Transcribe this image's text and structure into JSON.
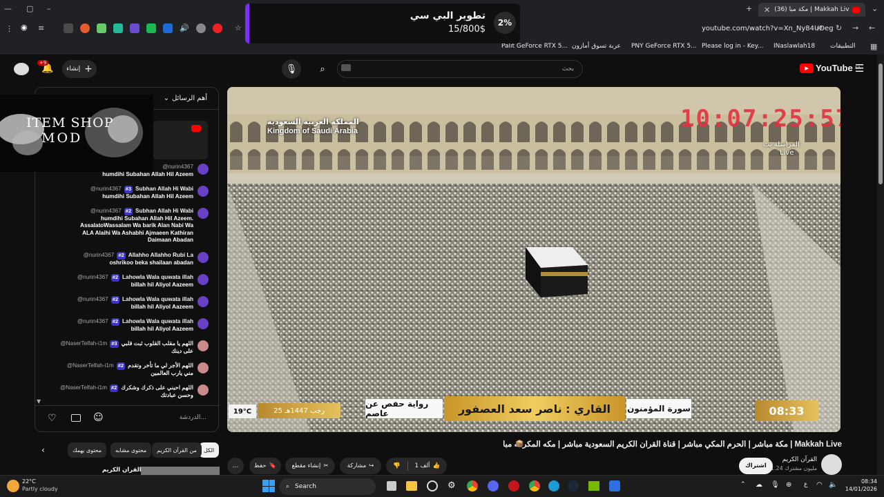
{
  "browser": {
    "tab_title": "(36) ‫ً Makkah Live | مكة مبا",
    "url": "youtube.com/watch?v=Xn_Ny84UDeg",
    "bookmarks": [
      "التطبيقات",
      "INaslawlah18",
      "Please log in - Key...",
      "PNY GeForce RTX 5...",
      "عربة تسوق أمازون",
      "Palit GeForce RTX 5..."
    ]
  },
  "promo": {
    "percent": "2%",
    "title": "تطوير البي سي",
    "amount": "15/800$"
  },
  "header": {
    "logo_text": "YouTube",
    "logo_region": "SA",
    "search_placeholder": "بحث",
    "create_label": "إنشاء",
    "notif_count": "+9"
  },
  "chat": {
    "mode_label": "أهم الرسائل",
    "input_placeholder": "الدردشة...",
    "messages": [
      {
        "author": "@nurin4367",
        "badge": "",
        "text": "",
        "line2": "humdihi Subahan Allah Hil Azeem"
      },
      {
        "author": "@nurin4367",
        "badge": "#3",
        "text": "Subhan Allah Hi Wabi",
        "line2": "humdihi Subahan Allah Hil Azeem"
      },
      {
        "author": "@nurin4367",
        "badge": "#2",
        "text": "Subhan Allah Hi Wabi",
        "line2": "humdihi Subahan Allah Hil Azeem. AssalatoWassalam Wa barik Alan Nabi Wa ALA Alaihi Wa Ashabhi Ajmaeen Kathiran Daimaan Abadan"
      },
      {
        "author": "@nurin4367",
        "badge": "#2",
        "text": "Allahho Allahho Rubi La",
        "line2": "oshrikoo beka shailaan abadan"
      },
      {
        "author": "@nurin4367",
        "badge": "#2",
        "text": "Lahowla Wala quwata illah",
        "line2": "billah hil Aliyol Aazeem"
      },
      {
        "author": "@nurin4367",
        "badge": "#2",
        "text": "Lahowla Wala quwata illah",
        "line2": "billah hil Aliyol Aazeem"
      },
      {
        "author": "@nurin4367",
        "badge": "#2",
        "text": "Lahowla Wala quwata illah",
        "line2": "billah hil Aliyol Aazeem"
      },
      {
        "author": "@NaserTelfah-i1m",
        "badge": "#3",
        "text": "اللهم يا مقلب القلوب ثبت قلبي",
        "line2": "على دينك"
      },
      {
        "author": "@NaserTelfah-i1m",
        "badge": "#2",
        "text": "اللهم الأجر لي ما تأخر وتقدم",
        "line2": "مني يارب العالمين"
      },
      {
        "author": "@NaserTelfah-i1m",
        "badge": "#2",
        "text": "اللهم احيني على ذكرك وشكرك",
        "line2": "وحسن عبادتك"
      }
    ]
  },
  "overlay_mod": {
    "line1": "ITEM SHOP",
    "line2": "MOD"
  },
  "video": {
    "kingdom_ar": "المملكة العربية السعودية",
    "kingdom_en": "Kingdom of Saudi Arabia",
    "clock": "10:07:25:57",
    "live_label": "Live",
    "channel_ar": "المراسلة بث",
    "surah": "سورة المؤمنون",
    "reciter": "القاري : ناصر سعد العصفور",
    "riwaya": "رواية حفص عن عاصم",
    "hijri_date": "25 رجب 1447هـ",
    "temperature": "19°C",
    "time": "08:33"
  },
  "below": {
    "title": "مكة مباشر | الحرم المكي مباشر | قناة القران الكريم السعودية مباشر | مكه المكرمه مبا | Makkah Live",
    "channel_name": "القرآن الكريم",
    "subscribers": "1.24 مليون مشترك",
    "subscribe_label": "اشتراك",
    "likes": "1 ألف",
    "share_label": "مشاركة",
    "clip_label": "إنشاء مقطع",
    "save_label": "حفظ",
    "more_label": "…"
  },
  "chips": [
    "الكل",
    "من القرآن الكريم",
    "محتوى مشابه",
    "محتوى يهمك"
  ],
  "next_video": {
    "title": "بث مباشر || قناة القرآن الكريم Makkah"
  },
  "taskbar": {
    "weather_temp": "22°C",
    "weather_desc": "Partly cloudy",
    "search_label": "Search",
    "time": "08:34",
    "date": "14/01/2026",
    "lang": "ع"
  }
}
